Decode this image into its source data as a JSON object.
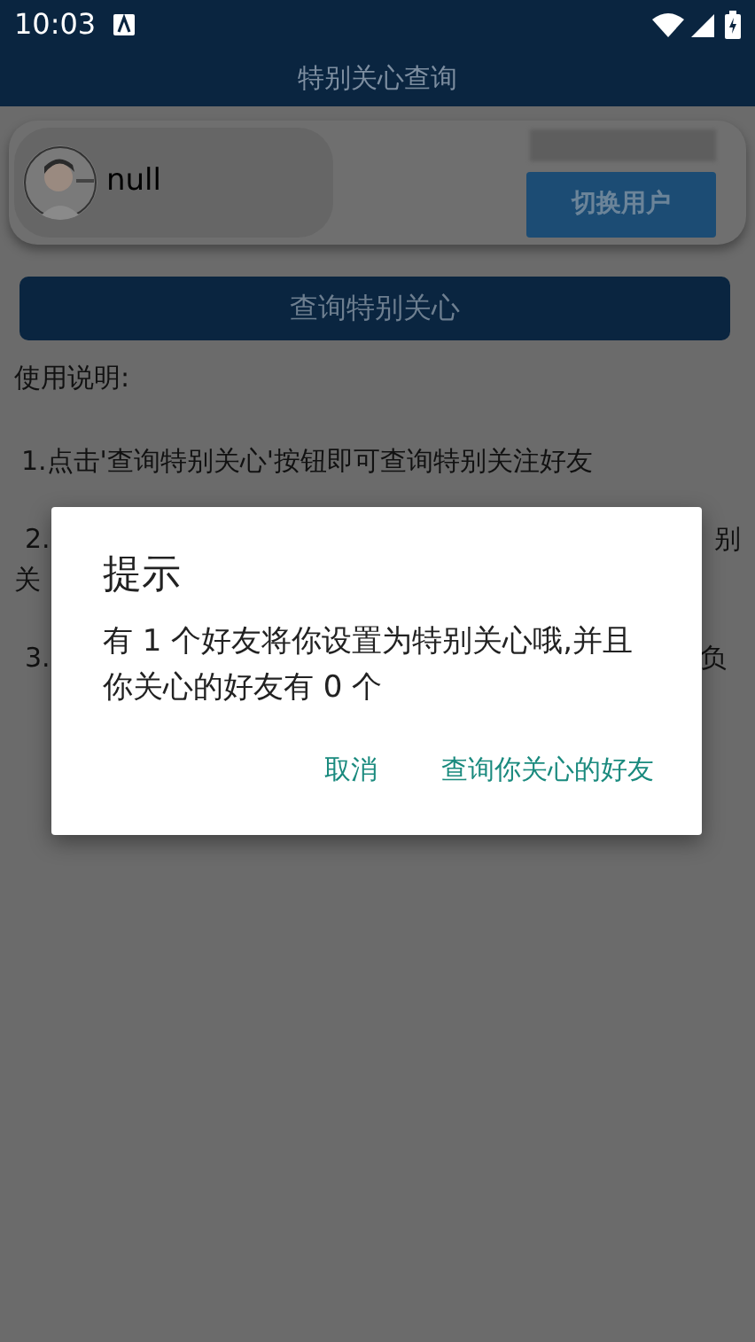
{
  "status_bar": {
    "time": "10:03"
  },
  "app_bar": {
    "title": "特别关心查询"
  },
  "user_card": {
    "name": "null",
    "switch_button": "切换用户"
  },
  "query_button": "查询特别关心",
  "instructions": {
    "heading": "使用说明:",
    "line_1": "1.点击'查询特别关心'按钮即可查询特别关注好友",
    "line_2_start": "2.",
    "line_2_end": "别",
    "line_2_wrap": "关",
    "line_3_start": "3.",
    "line_3_end": "负"
  },
  "dialog": {
    "title": "提示",
    "message": "有 1 个好友将你设置为特别关心哦,并且你关心的好友有 0 个",
    "buttons": [
      "取消",
      "查询你关心的好友"
    ]
  }
}
